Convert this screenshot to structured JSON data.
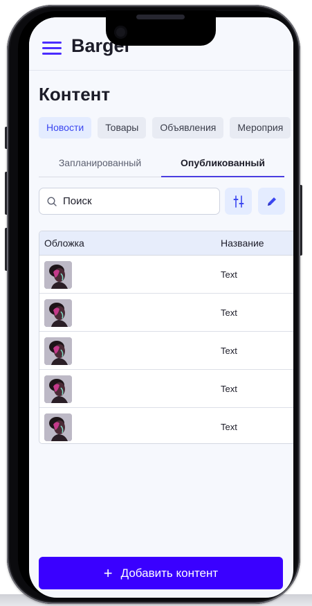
{
  "app": {
    "brand": "Bargel"
  },
  "page": {
    "title": "Контент"
  },
  "chips": [
    {
      "label": "Новости",
      "active": true
    },
    {
      "label": "Товары",
      "active": false
    },
    {
      "label": "Объявления",
      "active": false
    },
    {
      "label": "Мероприя",
      "active": false
    }
  ],
  "tabs": [
    {
      "label": "Запланированный",
      "active": false
    },
    {
      "label": "Опубликованный",
      "active": true
    }
  ],
  "search": {
    "placeholder": "Поиск",
    "value": ""
  },
  "table": {
    "headers": {
      "cover": "Обложка",
      "name": "Название"
    },
    "rows": [
      {
        "name": "Text"
      },
      {
        "name": "Text"
      },
      {
        "name": "Text"
      },
      {
        "name": "Text"
      },
      {
        "name": "Text"
      }
    ]
  },
  "actions": {
    "add_label": "Добавить контент"
  },
  "colors": {
    "accent": "#3a00ff",
    "accent_soft": "#e4ecff",
    "menu_icon": "#4a2cff",
    "screen_bg": "#f6f8fd"
  },
  "icons": [
    "menu-icon",
    "search-icon",
    "filter-sliders-icon",
    "pencil-icon",
    "plus-icon",
    "cover-thumbnail-image"
  ]
}
